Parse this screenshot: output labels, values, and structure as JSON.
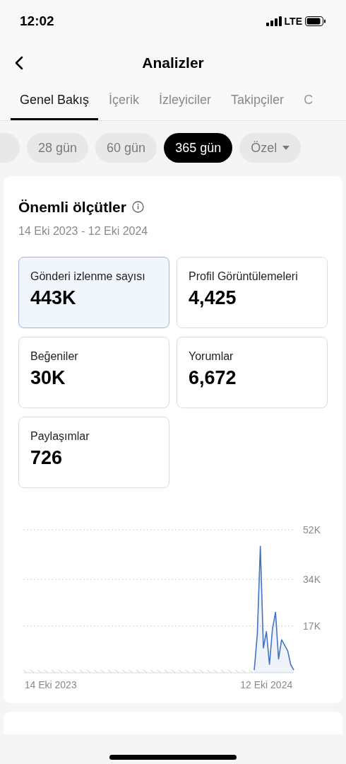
{
  "status_bar": {
    "time": "12:02",
    "network": "LTE"
  },
  "header": {
    "title": "Analizler"
  },
  "tabs": [
    {
      "label": "Genel Bakış",
      "selected": true
    },
    {
      "label": "İçerik",
      "selected": false
    },
    {
      "label": "İzleyiciler",
      "selected": false
    },
    {
      "label": "Takipçiler",
      "selected": false
    },
    {
      "label": "C",
      "selected": false
    }
  ],
  "ranges": [
    {
      "label": "28 gün",
      "selected": false
    },
    {
      "label": "60 gün",
      "selected": false
    },
    {
      "label": "365 gün",
      "selected": true
    },
    {
      "label": "Özel",
      "selected": false,
      "kind": "dropdown"
    }
  ],
  "metrics_card": {
    "title": "Önemli ölçütler",
    "date_range": "14 Eki 2023 - 12 Eki 2024",
    "metrics": [
      {
        "label": "Gönderi izlenme sayısı",
        "value": "443K",
        "selected": true
      },
      {
        "label": "Profil Görüntülemeleri",
        "value": "4,425",
        "selected": false
      },
      {
        "label": "Beğeniler",
        "value": "30K",
        "selected": false
      },
      {
        "label": "Yorumlar",
        "value": "6,672",
        "selected": false
      },
      {
        "label": "Paylaşımlar",
        "value": "726",
        "selected": false
      }
    ],
    "chart_data": {
      "type": "area",
      "ylim": [
        0,
        52000
      ],
      "yticks": [
        {
          "value": 17000,
          "label": "17K"
        },
        {
          "value": 34000,
          "label": "34K"
        },
        {
          "value": 52000,
          "label": "52K"
        }
      ],
      "categories": [
        null,
        null,
        null,
        null,
        null,
        null,
        null,
        null,
        null,
        "14 Eki 2023",
        null,
        null,
        null,
        null,
        null,
        null,
        null,
        null,
        null,
        null,
        null,
        null,
        null,
        null,
        null,
        null,
        null,
        null,
        null,
        null,
        null,
        null,
        null,
        null,
        null,
        null,
        null,
        null,
        null,
        null,
        null,
        null,
        null,
        null,
        null,
        null,
        null,
        null,
        null,
        null,
        null,
        null,
        null,
        null,
        null,
        null,
        null,
        null,
        null,
        null,
        null,
        null,
        null,
        null,
        null,
        null,
        null,
        null,
        null,
        null,
        null,
        null,
        null,
        null,
        null,
        null,
        null,
        null,
        null,
        null,
        "12 Eki 2024",
        null,
        null,
        null,
        null,
        null,
        null,
        null,
        null,
        null
      ],
      "series": [
        {
          "color": "#4472c4",
          "values": [
            null,
            null,
            null,
            null,
            null,
            null,
            null,
            null,
            null,
            null,
            null,
            null,
            null,
            null,
            null,
            null,
            null,
            null,
            null,
            null,
            null,
            null,
            null,
            null,
            null,
            null,
            null,
            null,
            null,
            null,
            null,
            null,
            null,
            null,
            null,
            null,
            null,
            null,
            null,
            null,
            null,
            null,
            null,
            null,
            null,
            null,
            null,
            null,
            null,
            null,
            null,
            null,
            null,
            null,
            null,
            null,
            null,
            null,
            null,
            null,
            null,
            null,
            null,
            null,
            null,
            null,
            null,
            null,
            null,
            null,
            null,
            null,
            null,
            null,
            null,
            null,
            1000,
            14000,
            46000,
            9000,
            15000,
            3000,
            16000,
            22000,
            5000,
            12000,
            10000,
            8000,
            3000,
            1000
          ]
        }
      ]
    }
  }
}
